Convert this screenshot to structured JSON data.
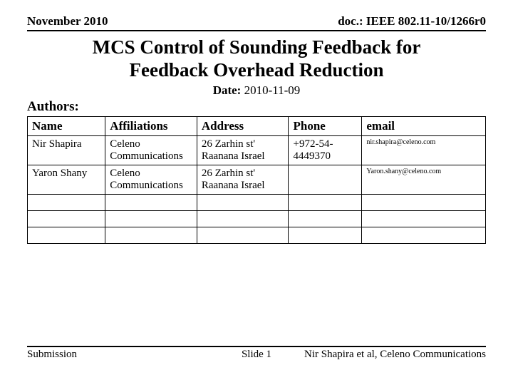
{
  "header": {
    "left": "November 2010",
    "right": "doc.: IEEE 802.11-10/1266r0"
  },
  "title_line1": "MCS Control of Sounding Feedback for",
  "title_line2": "Feedback Overhead Reduction",
  "date_label": "Date:",
  "date_value": "2010-11-09",
  "authors_label": "Authors:",
  "table": {
    "headers": {
      "name": "Name",
      "affiliations": "Affiliations",
      "address": "Address",
      "phone": "Phone",
      "email": "email"
    },
    "rows": [
      {
        "name": "Nir Shapira",
        "affiliations": "Celeno Communications",
        "address": "26 Zarhin st' Raanana Israel",
        "phone": "+972-54-4449370",
        "email": "nir.shapira@celeno.com"
      },
      {
        "name": "Yaron Shany",
        "affiliations": "Celeno Communications",
        "address": "26 Zarhin st' Raanana Israel",
        "phone": "",
        "email": "Yaron.shany@celeno.com"
      },
      {
        "name": "",
        "affiliations": "",
        "address": "",
        "phone": "",
        "email": ""
      },
      {
        "name": "",
        "affiliations": "",
        "address": "",
        "phone": "",
        "email": ""
      },
      {
        "name": "",
        "affiliations": "",
        "address": "",
        "phone": "",
        "email": ""
      }
    ]
  },
  "footer": {
    "left": "Submission",
    "center": "Slide 1",
    "right": "Nir Shapira et al, Celeno Communications"
  }
}
